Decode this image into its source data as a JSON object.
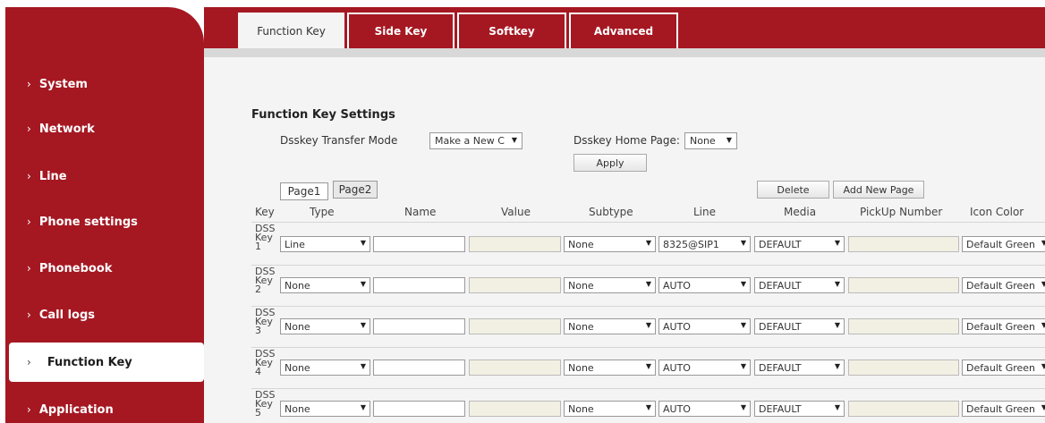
{
  "sidebar": {
    "items": [
      {
        "label": "System"
      },
      {
        "label": "Network"
      },
      {
        "label": "Line"
      },
      {
        "label": "Phone settings"
      },
      {
        "label": "Phonebook"
      },
      {
        "label": "Call logs"
      },
      {
        "label": "Function Key",
        "active": true
      },
      {
        "label": "Application"
      }
    ],
    "chevron": "›"
  },
  "tabs": [
    {
      "label": "Function Key",
      "active": true
    },
    {
      "label": "Side Key"
    },
    {
      "label": "Softkey"
    },
    {
      "label": "Advanced"
    }
  ],
  "settings": {
    "title": "Function Key Settings",
    "transfer_mode_label": "Dsskey Transfer Mode",
    "transfer_mode_value": "Make a New C",
    "home_page_label": "Dsskey Home Page:",
    "home_page_value": "None",
    "apply_label": "Apply"
  },
  "pages": {
    "page1": "Page1",
    "page2": "Page2",
    "delete_label": "Delete",
    "add_label": "Add New Page"
  },
  "table": {
    "headers": [
      "Key",
      "Type",
      "Name",
      "Value",
      "Subtype",
      "Line",
      "Media",
      "PickUp Number",
      "Icon Color"
    ],
    "rows": [
      {
        "key": [
          "DSS",
          "Key",
          "1"
        ],
        "type": "Line",
        "name": "",
        "value": "",
        "subtype": "None",
        "line": "8325@SIP1",
        "media": "DEFAULT",
        "pickup": "",
        "icon_color": "Default Green"
      },
      {
        "key": [
          "DSS",
          "Key",
          "2"
        ],
        "type": "None",
        "name": "",
        "value": "",
        "subtype": "None",
        "line": "AUTO",
        "media": "DEFAULT",
        "pickup": "",
        "icon_color": "Default Green"
      },
      {
        "key": [
          "DSS",
          "Key",
          "3"
        ],
        "type": "None",
        "name": "",
        "value": "",
        "subtype": "None",
        "line": "AUTO",
        "media": "DEFAULT",
        "pickup": "",
        "icon_color": "Default Green"
      },
      {
        "key": [
          "DSS",
          "Key",
          "4"
        ],
        "type": "None",
        "name": "",
        "value": "",
        "subtype": "None",
        "line": "AUTO",
        "media": "DEFAULT",
        "pickup": "",
        "icon_color": "Default Green"
      },
      {
        "key": [
          "DSS",
          "Key",
          "5"
        ],
        "type": "None",
        "name": "",
        "value": "",
        "subtype": "None",
        "line": "AUTO",
        "media": "DEFAULT",
        "pickup": "",
        "icon_color": "Default Green"
      }
    ]
  },
  "icons": {
    "dropdown": "▼"
  },
  "colors": {
    "brand": "#a51822",
    "content_bg": "#f4f4f4",
    "readonly_bg": "#f2f0e3"
  }
}
